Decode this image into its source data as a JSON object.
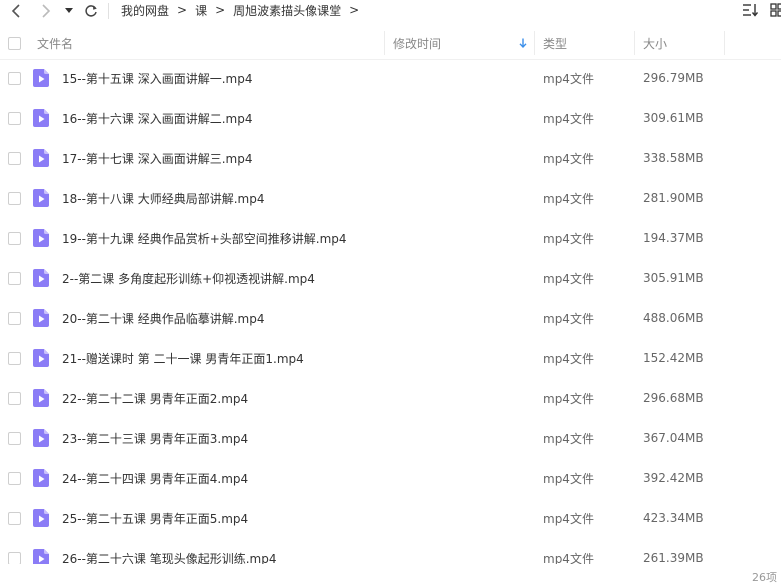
{
  "toolbar": {
    "breadcrumb": [
      "我的网盘",
      "课",
      "周旭波素描头像课堂"
    ],
    "separator": ">"
  },
  "header": {
    "name": "文件名",
    "modified": "修改时间",
    "type": "类型",
    "size": "大小"
  },
  "files": [
    {
      "name": "15--第十五课 深入画面讲解一.mp4",
      "type": "mp4文件",
      "size": "296.79MB"
    },
    {
      "name": "16--第十六课 深入画面讲解二.mp4",
      "type": "mp4文件",
      "size": "309.61MB"
    },
    {
      "name": "17--第十七课 深入画面讲解三.mp4",
      "type": "mp4文件",
      "size": "338.58MB"
    },
    {
      "name": "18--第十八课 大师经典局部讲解.mp4",
      "type": "mp4文件",
      "size": "281.90MB"
    },
    {
      "name": "19--第十九课 经典作品赏析+头部空间推移讲解.mp4",
      "type": "mp4文件",
      "size": "194.37MB"
    },
    {
      "name": "2--第二课 多角度起形训练+仰视透视讲解.mp4",
      "type": "mp4文件",
      "size": "305.91MB"
    },
    {
      "name": "20--第二十课 经典作品临摹讲解.mp4",
      "type": "mp4文件",
      "size": "488.06MB"
    },
    {
      "name": "21--赠送课时 第 二十一课 男青年正面1.mp4",
      "type": "mp4文件",
      "size": "152.42MB"
    },
    {
      "name": "22--第二十二课 男青年正面2.mp4",
      "type": "mp4文件",
      "size": "296.68MB"
    },
    {
      "name": "23--第二十三课 男青年正面3.mp4",
      "type": "mp4文件",
      "size": "367.04MB"
    },
    {
      "name": "24--第二十四课 男青年正面4.mp4",
      "type": "mp4文件",
      "size": "392.42MB"
    },
    {
      "name": "25--第二十五课 男青年正面5.mp4",
      "type": "mp4文件",
      "size": "423.34MB"
    },
    {
      "name": "26--第二十六课 笔现头像起形训练.mp4",
      "type": "mp4文件",
      "size": "261.39MB"
    }
  ],
  "footer": {
    "count": "26项"
  },
  "colors": {
    "video_icon": "#8b7cf6",
    "video_icon_fold": "#c9c0fb",
    "sort_arrow": "#3b8fea"
  },
  "icons": {
    "back": "chevron-left-icon",
    "forward": "chevron-right-icon",
    "history": "caret-down-icon",
    "refresh": "refresh-icon",
    "sort": "sort-icon",
    "view": "grid-view-icon",
    "file": "video-file-icon"
  }
}
